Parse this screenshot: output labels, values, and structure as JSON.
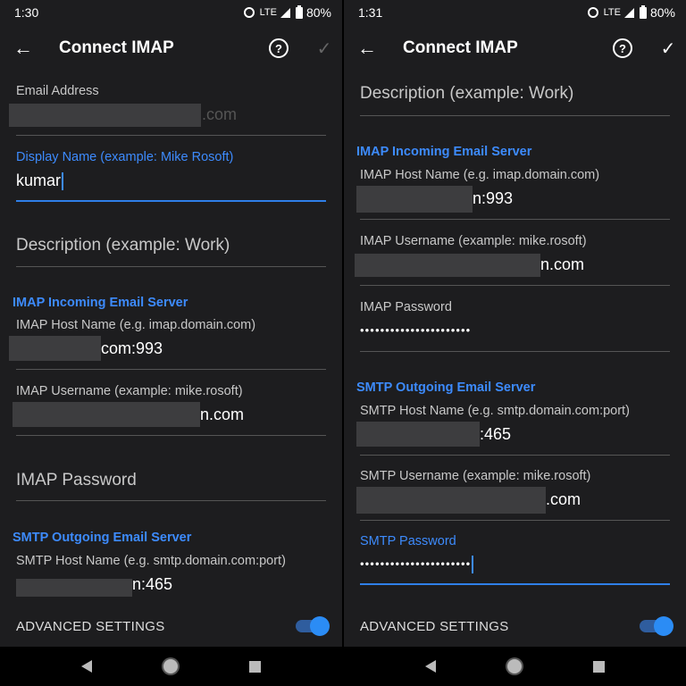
{
  "left": {
    "status": {
      "time": "1:30",
      "network": "LTE",
      "battery": "80%"
    },
    "appbar": {
      "title": "Connect IMAP"
    },
    "email": {
      "label": "Email Address",
      "value_suffix": ".com"
    },
    "display_name": {
      "label": "Display Name (example: Mike Rosoft)",
      "value": "kumar"
    },
    "description": {
      "placeholder": "Description (example: Work)"
    },
    "imap_section": "IMAP Incoming Email Server",
    "imap_host": {
      "label": "IMAP Host Name (e.g. imap.domain.com)",
      "value_suffix": "com:993"
    },
    "imap_user": {
      "label": "IMAP Username (example: mike.rosoft)",
      "value_suffix": "n.com"
    },
    "imap_password": {
      "placeholder": "IMAP Password"
    },
    "smtp_section": "SMTP Outgoing Email Server",
    "smtp_host": {
      "label": "SMTP Host Name (e.g. smtp.domain.com:port)",
      "value_suffix": "n:465"
    },
    "advanced": {
      "label": "ADVANCED SETTINGS",
      "enabled": true
    }
  },
  "right": {
    "status": {
      "time": "1:31",
      "network": "LTE",
      "battery": "80%"
    },
    "appbar": {
      "title": "Connect IMAP"
    },
    "description": {
      "placeholder": "Description (example: Work)"
    },
    "imap_section": "IMAP Incoming Email Server",
    "imap_host": {
      "label": "IMAP Host Name (e.g. imap.domain.com)",
      "value_suffix": "n:993"
    },
    "imap_user": {
      "label": "IMAP Username (example: mike.rosoft)",
      "value_suffix": "n.com"
    },
    "imap_password": {
      "label": "IMAP Password",
      "value": "••••••••••••••••••••••"
    },
    "smtp_section": "SMTP Outgoing Email Server",
    "smtp_host": {
      "label": "SMTP Host Name (e.g. smtp.domain.com:port)",
      "value_suffix": ":465"
    },
    "smtp_user": {
      "label": "SMTP Username (example: mike.rosoft)",
      "value_suffix": ".com"
    },
    "smtp_password": {
      "label": "SMTP Password",
      "value": "••••••••••••••••••••••"
    },
    "advanced": {
      "label": "ADVANCED SETTINGS",
      "enabled": true
    }
  },
  "icons": {
    "back": "arrow-left",
    "help": "question-circle",
    "confirm": "checkmark",
    "alarm": "alarm-clock",
    "signal": "cell-signal",
    "battery": "battery"
  },
  "help_glyph": "?",
  "colors": {
    "accent": "#3d8bfd",
    "background": "#1d1d1f",
    "redaction": "#3d3d3f"
  }
}
